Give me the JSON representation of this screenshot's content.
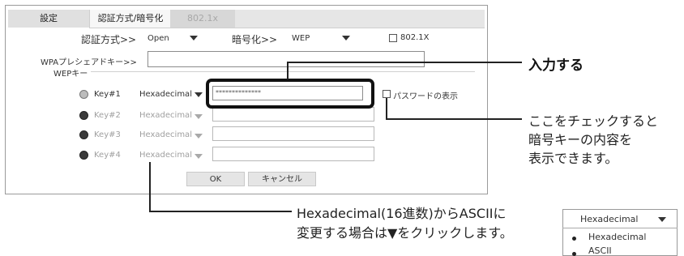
{
  "tabs": {
    "settings": "設定",
    "auth": "認証方式/暗号化",
    "dot1x": "802.1x"
  },
  "auth_method": {
    "label": "認証方式>>",
    "value": "Open"
  },
  "encryption": {
    "label": "暗号化>>",
    "value": "WEP"
  },
  "dot1x_checkbox": {
    "label": "802.1X",
    "checked": false
  },
  "wpa_psk": {
    "label": "WPAプレシェアドキー>>",
    "value": ""
  },
  "wep_group_label": "WEPキー",
  "wep_keys": [
    {
      "label": "Key#1",
      "format": "Hexadecimal",
      "value": "**************",
      "enabled": true
    },
    {
      "label": "Key#2",
      "format": "Hexadecimal",
      "value": "",
      "enabled": false
    },
    {
      "label": "Key#3",
      "format": "Hexadecimal",
      "value": "",
      "enabled": false
    },
    {
      "label": "Key#4",
      "format": "Hexadecimal",
      "value": "",
      "enabled": false
    }
  ],
  "show_password": {
    "label": "パスワードの表示",
    "checked": false
  },
  "buttons": {
    "ok": "OK",
    "cancel": "キャンセル"
  },
  "annotations": {
    "input": "入力する",
    "checkbox_note_1": "ここをチェックすると",
    "checkbox_note_2": "暗号キーの内容を",
    "checkbox_note_3": "表示できます。",
    "format_note_1": "Hexadecimal(16進数)からASCIIに",
    "format_note_2": "変更する場合は▼をクリックします。"
  },
  "dropdown_example": {
    "selected": "Hexadecimal",
    "options": [
      "Hexadecimal",
      "ASCII"
    ]
  }
}
